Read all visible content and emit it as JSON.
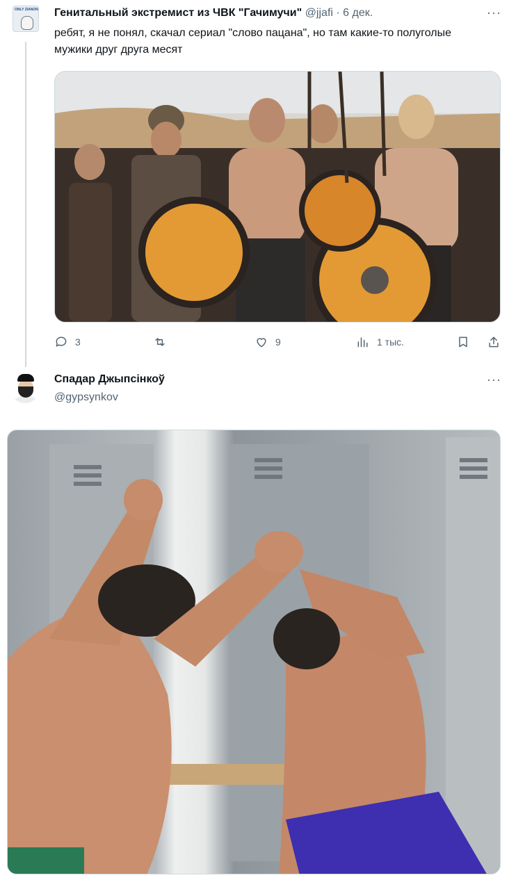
{
  "tweet1": {
    "author_name": "Генитальный экстремист из ЧВК \"Гачимучи\"",
    "handle": "@jjafi",
    "separator": "·",
    "date": "6 дек.",
    "more_label": "···",
    "text": "ребят, я не понял, скачал сериал \"слово пацана\", но там какие-то полуголые мужики друг друга месят",
    "avatar_text": "ONLY ZIANON",
    "media_icon": "photo-vikings",
    "actions": {
      "replies": "3",
      "reposts": "",
      "likes": "9",
      "views": "1 тыс."
    },
    "action_icons": [
      "reply-icon",
      "repost-icon",
      "like-icon",
      "views-icon",
      "bookmark-icon",
      "share-icon"
    ]
  },
  "tweet2": {
    "author_name": "Спадар Джыпсінкоў",
    "handle": "@gypsynkov",
    "more_label": "···",
    "media_icon": "photo-locker-room"
  },
  "colors": {
    "text": "#0f1419",
    "secondary": "#536471",
    "border": "#cfd9de",
    "background": "#ffffff"
  }
}
